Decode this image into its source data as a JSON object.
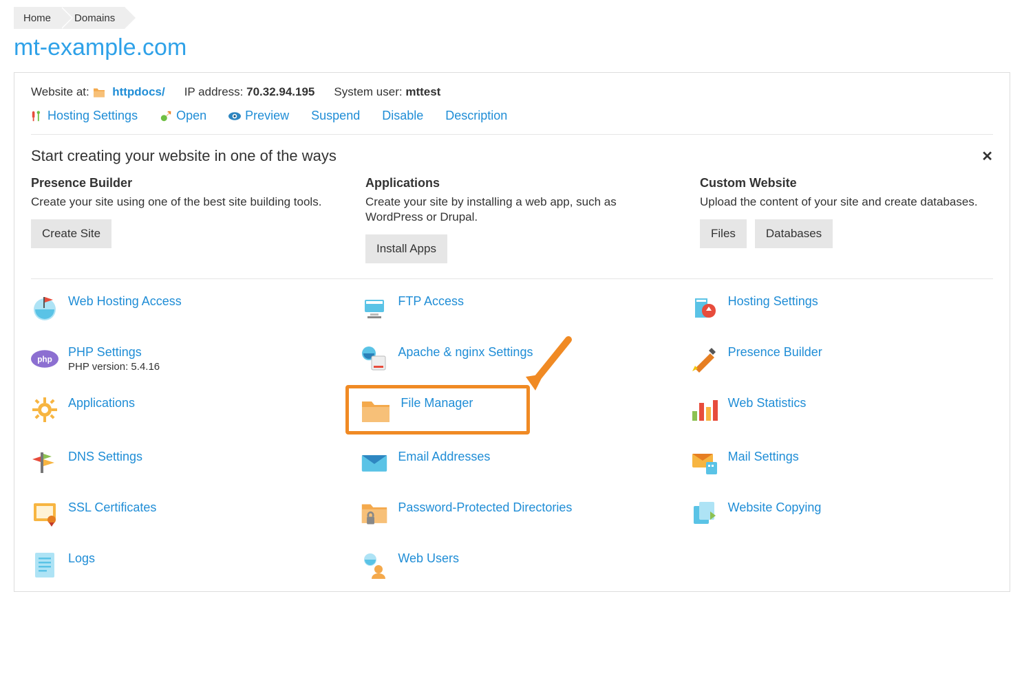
{
  "breadcrumb": {
    "home": "Home",
    "domains": "Domains"
  },
  "page_title": "mt-example.com",
  "meta": {
    "website_at_label": "Website at:",
    "httpdocs": "httpdocs/",
    "ip_label": "IP address:",
    "ip_value": "70.32.94.195",
    "sysuser_label": "System user:",
    "sysuser_value": "mttest"
  },
  "actions": {
    "hosting_settings": "Hosting Settings",
    "open": "Open",
    "preview": "Preview",
    "suspend": "Suspend",
    "disable": "Disable",
    "description": "Description"
  },
  "section_title": "Start creating your website in one of the ways",
  "cols": {
    "presence": {
      "title": "Presence Builder",
      "desc": "Create your site using one of the best site building tools.",
      "btn": "Create Site"
    },
    "apps": {
      "title": "Applications",
      "desc": "Create your site by installing a web app, such as WordPress or Drupal.",
      "btn": "Install Apps"
    },
    "custom": {
      "title": "Custom Website",
      "desc": "Upload the content of your site and create databases.",
      "btn_files": "Files",
      "btn_db": "Databases"
    }
  },
  "tiles": {
    "web_hosting_access": "Web Hosting Access",
    "ftp_access": "FTP Access",
    "hosting_settings": "Hosting Settings",
    "php_settings": "PHP Settings",
    "php_version": "PHP version: 5.4.16",
    "apache_nginx": "Apache & nginx Settings",
    "presence_builder": "Presence Builder",
    "applications": "Applications",
    "file_manager": "File Manager",
    "web_statistics": "Web Statistics",
    "dns_settings": "DNS Settings",
    "email_addresses": "Email Addresses",
    "mail_settings": "Mail Settings",
    "ssl_certificates": "SSL Certificates",
    "password_protected": "Password-Protected Directories",
    "website_copying": "Website Copying",
    "logs": "Logs",
    "web_users": "Web Users"
  }
}
